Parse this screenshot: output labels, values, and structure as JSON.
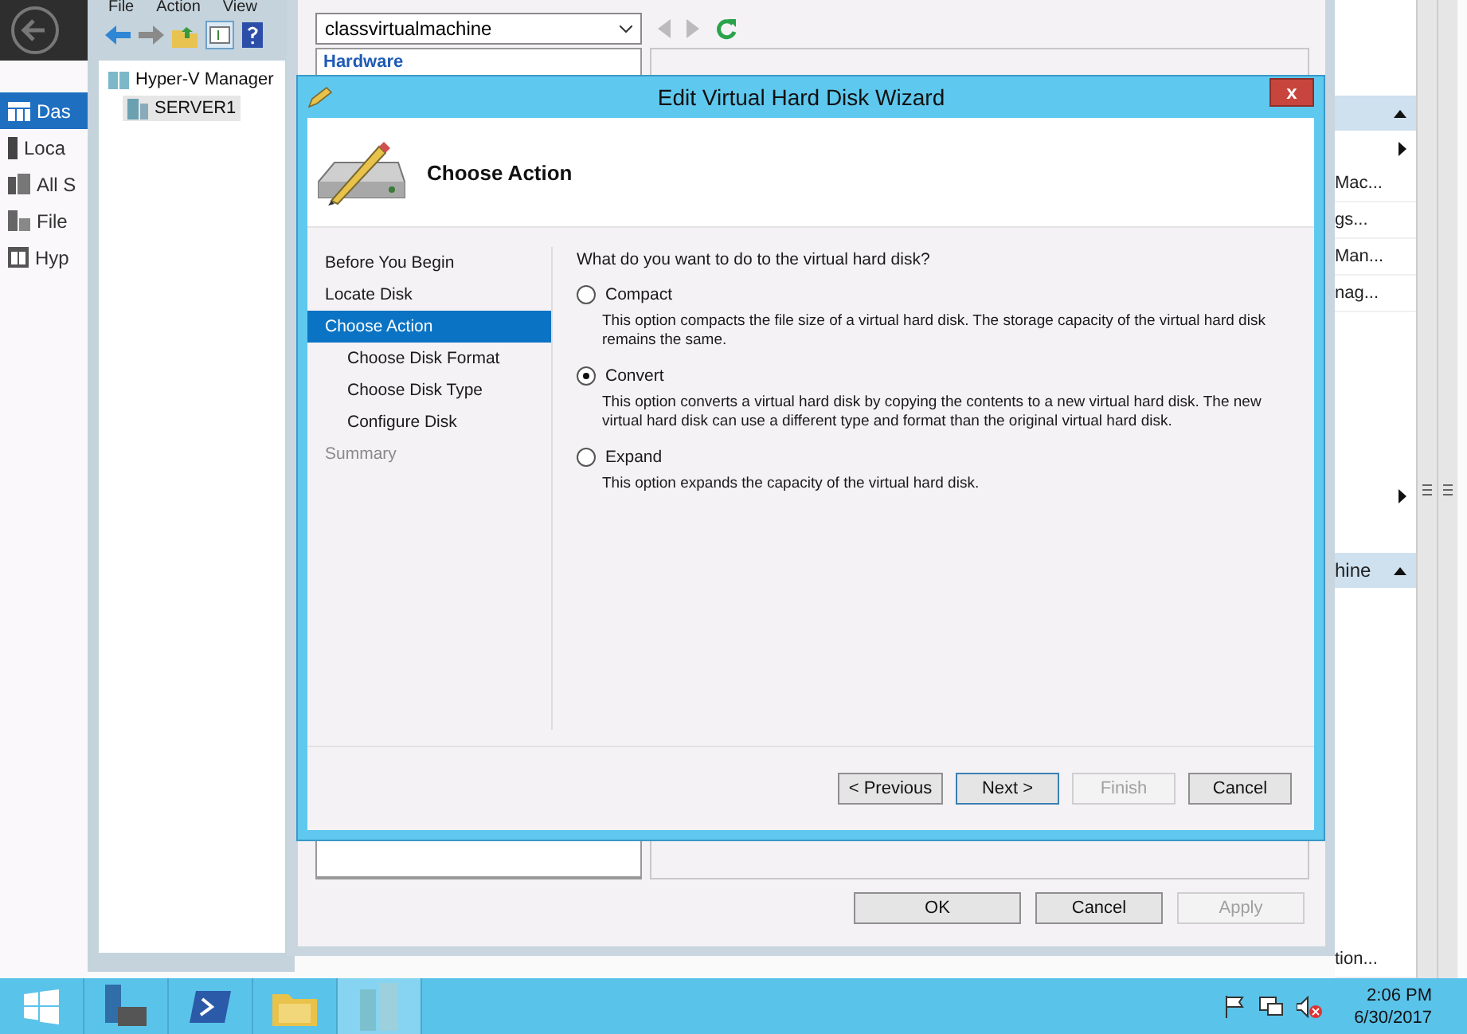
{
  "server_manager": {
    "nav": [
      {
        "label": "Das",
        "selected": true
      },
      {
        "label": "Loca",
        "selected": false
      },
      {
        "label": "All S",
        "selected": false
      },
      {
        "label": "File",
        "selected": false
      },
      {
        "label": "Hyp",
        "selected": false
      }
    ]
  },
  "hyperv_manager": {
    "menu": [
      "File",
      "Action",
      "View"
    ],
    "tree": [
      {
        "label": "Hyper-V Manager",
        "selected": false,
        "children": [
          {
            "label": "SERVER1",
            "selected": true
          }
        ]
      }
    ]
  },
  "settings_window": {
    "vm_select": "classvirtualmachine",
    "hardware_heading": "Hardware",
    "buttons": [
      {
        "label": "OK",
        "disabled": false
      },
      {
        "label": "Cancel",
        "disabled": false
      },
      {
        "label": "Apply",
        "disabled": true
      }
    ]
  },
  "actions_pane": {
    "sections": [
      {
        "items": [
          "Mac...",
          "gs...",
          "Man...",
          "nag..."
        ]
      },
      {
        "title": "hine",
        "items": [
          "tion..."
        ]
      }
    ]
  },
  "wizard": {
    "title": "Edit Virtual Hard Disk Wizard",
    "close": "x",
    "heading": "Choose Action",
    "steps": [
      {
        "label": "Before You Begin",
        "selected": false,
        "disabled": false
      },
      {
        "label": "Locate Disk",
        "selected": false,
        "disabled": false
      },
      {
        "label": "Choose Action",
        "selected": true,
        "disabled": false,
        "children": [
          {
            "label": "Choose Disk Format",
            "selected": false,
            "disabled": false
          },
          {
            "label": "Choose Disk Type",
            "selected": false,
            "disabled": false
          },
          {
            "label": "Configure Disk",
            "selected": false,
            "disabled": false
          }
        ]
      },
      {
        "label": "Summary",
        "selected": false,
        "disabled": true
      }
    ],
    "question": "What do you want to do to the virtual hard disk?",
    "options": [
      {
        "label": "Compact",
        "selected": false,
        "description": "This option compacts the file size of a virtual hard disk. The storage capacity of the virtual hard disk remains the same."
      },
      {
        "label": "Convert",
        "selected": true,
        "description": "This option converts a virtual hard disk by copying the contents to a new virtual hard disk. The new virtual hard disk can use a different type and format than the original virtual hard disk."
      },
      {
        "label": "Expand",
        "selected": false,
        "description": "This option expands the capacity of the virtual hard disk."
      }
    ],
    "buttons": [
      {
        "label": "< Previous",
        "disabled": false,
        "default": false
      },
      {
        "label": "Next >",
        "disabled": false,
        "default": true
      },
      {
        "label": "Finish",
        "disabled": true,
        "default": false
      },
      {
        "label": "Cancel",
        "disabled": false,
        "default": false
      }
    ]
  },
  "taskbar": {
    "time": "2:06 PM",
    "date": "6/30/2017"
  }
}
